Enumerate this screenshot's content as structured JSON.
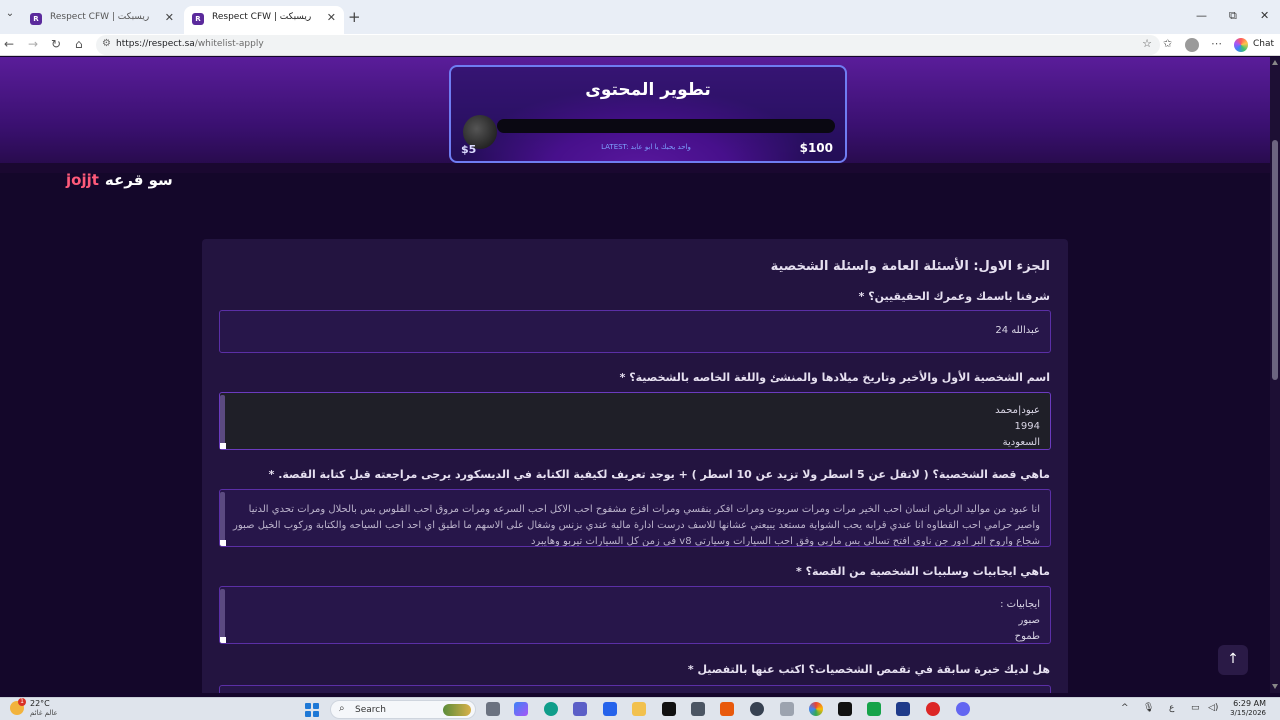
{
  "browser": {
    "tabs": [
      {
        "label": "Respect CFW | ريسبكت",
        "favicon": "R"
      },
      {
        "label": "Respect CFW | ريسبكت",
        "favicon": "R"
      }
    ],
    "new_tab_symbol": "+",
    "window_controls": {
      "minimize": "—",
      "maximize": "⧉",
      "close": "✕"
    },
    "url_host": "https://respect.sa",
    "url_path": "/whitelist-apply",
    "chat_label": "Chat"
  },
  "overlay": {
    "title": "تطوير المحتوى",
    "subtitle": "LATEST: واحد يحبك يا ابو عابد",
    "min_amount": "$5",
    "max_amount": "$100"
  },
  "site": {
    "logo_tag": "jojjt",
    "logo_text": "سو قرعه"
  },
  "form": {
    "section_title": "الجزء الاول: الأسئلة العامة واسئلة الشخصية",
    "questions": [
      {
        "label": "شرفنا باسمك وعمرك الحقيقيين؟ *",
        "answer_lines": [
          "عبدالله  24"
        ]
      },
      {
        "label": "اسم الشخصية الأول والأخير وتاريخ ميلادها والمنشئ واللغة الخاصه بالشخصية؟ *",
        "answer_lines": [
          "عبود|محمد",
          "1994",
          "السعودية"
        ]
      },
      {
        "label": "ماهي قصة الشخصية؟ ( لاتقل عن 5 اسطر ولا تزيد عن 10 اسطر ) + يوجد تعريف لكيفية الكتابة في الديسكورد يرجى مراجعته قبل كتابة القصة. *",
        "answer_paragraph": "انا عبود من مواليد الرياض انسان احب الخير مرات ومرات سربوت ومرات افكر بنفسي ومرات افزع مشفوح احب الاكل احب السرعه ومرات مروق احب الفلوس بس بالحلال ومرات تحدي الدنيا واصير حرامي احب القطاوه انا عندي قرابه يحب الشواية مستعد يبيعني عشانها للاسف درست ادارة مالية عندي بزنس وشغال على الاسهم ما اطيق اي احد احب السياحه والكتابة وركوب الخيل صبور شجاع واروح البر ادور جن ناوي افتح تسالي بس ماربي وفق احب السيارات وسيارتي v8 في زمن كل السيارات تيربو وهايبرد"
      },
      {
        "label": "ماهي ايجابيات وسلبيات الشخصية من القصة؟ *",
        "answer_lines": [
          "ايجابيات :",
          "صبور",
          "طموح"
        ]
      },
      {
        "label": "هل لديك خبرة سابقة في تقمص الشخصيات؟ اكتب عنها بالتفصيل *",
        "answer_lines": []
      }
    ]
  },
  "back_to_top": "↑",
  "taskbar": {
    "weather_temp": "22°C",
    "weather_desc": "عالم غائم",
    "weather_badge": "1",
    "search_label": "Search",
    "tray_lang": "ع",
    "time": "6:29 AM",
    "date": "3/15/2026"
  }
}
